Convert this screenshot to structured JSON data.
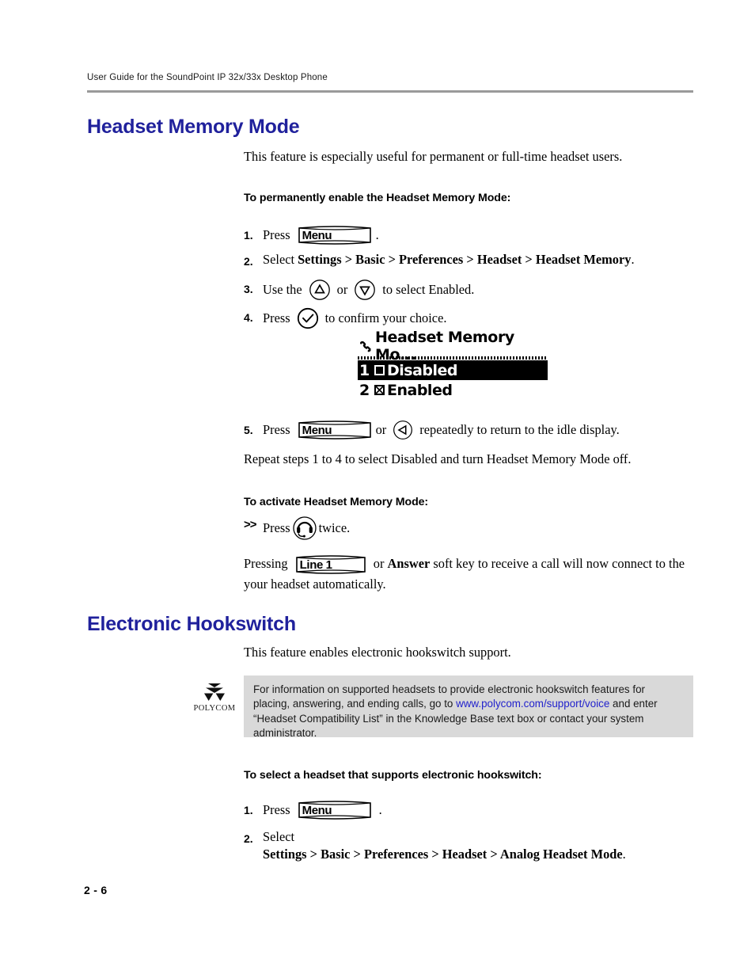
{
  "header": {
    "running_head": "User Guide for the SoundPoint IP 32x/33x Desktop Phone"
  },
  "sections": [
    {
      "title": "Headset Memory Mode",
      "intro": "This feature is especially useful for permanent or full-time headset users."
    },
    {
      "title": "Electronic Hookswitch",
      "intro": "This feature enables electronic hookswitch support."
    }
  ],
  "headings": {
    "permanently_enable": "To permanently enable the Headset Memory Mode:",
    "activate": "To activate Headset Memory Mode:",
    "select_headset": "To select a headset that supports electronic hookswitch:"
  },
  "steps_enable": [
    {
      "num": "1.",
      "pre": "Press",
      "key": "Menu",
      "post": "."
    },
    {
      "num": "2.",
      "pre": "Select",
      "nav": "Settings > Basic > Preferences > Headset > Headset Memory",
      "post": "."
    },
    {
      "num": "3.",
      "pre": "Use the",
      "mid": "or",
      "post": "to select Enabled."
    },
    {
      "num": "4.",
      "pre": "Press",
      "post": "to confirm your choice."
    },
    {
      "num": "5.",
      "pre": "Press",
      "key": "Menu",
      "mid": "or",
      "post": "repeatedly to return to the idle display."
    }
  ],
  "repeat_note": "Repeat steps 1 to 4 to select Disabled and turn Headset Memory Mode off.",
  "activate_step": {
    "marker": ">>",
    "pre": "Press",
    "post": "twice."
  },
  "pressing_note": {
    "pre": "Pressing",
    "key": "Line 1",
    "mid": "or",
    "bold": "Answer",
    "post": "soft key to receive a call will now connect to the your headset automatically."
  },
  "steps_select": [
    {
      "num": "1.",
      "pre": "Press",
      "key": "Menu",
      "post": "."
    },
    {
      "num": "2.",
      "pre": "Select",
      "nav": "Settings > Basic > Preferences > Headset > Analog Headset Mode",
      "post": "."
    }
  ],
  "lcd": {
    "title": "Headset Memory Mo...",
    "rows": [
      {
        "index": "1",
        "label": "Disabled",
        "checked": false,
        "selected": true
      },
      {
        "index": "2",
        "label": "Enabled",
        "checked": true,
        "selected": false
      }
    ]
  },
  "note": {
    "logo_word": "POLYCOM",
    "text_before_link": "For information on supported headsets to provide electronic hookswitch features for placing, answering, and ending calls, go to ",
    "link_text": "www.polycom.com/support/voice",
    "text_after_link": " and enter “Headset Compatibility List” in the Knowledge Base text box or contact your system administrator."
  },
  "footer": {
    "page_number": "2 - 6"
  },
  "colors": {
    "heading_blue": "#20219c",
    "link_blue": "#2222cc",
    "note_background": "#d9d9d9",
    "rule_gray": "#9a9a9a"
  },
  "icons": {
    "menu_key": "menu-hard-key",
    "line1_key": "line1-hard-key",
    "up_arrow": "up-arrow-key-icon",
    "down_arrow": "down-arrow-key-icon",
    "check": "check-key-icon",
    "left_arrow": "left-arrow-key-icon",
    "headset": "headset-key-icon",
    "lcd_handset": "handset-icon"
  }
}
